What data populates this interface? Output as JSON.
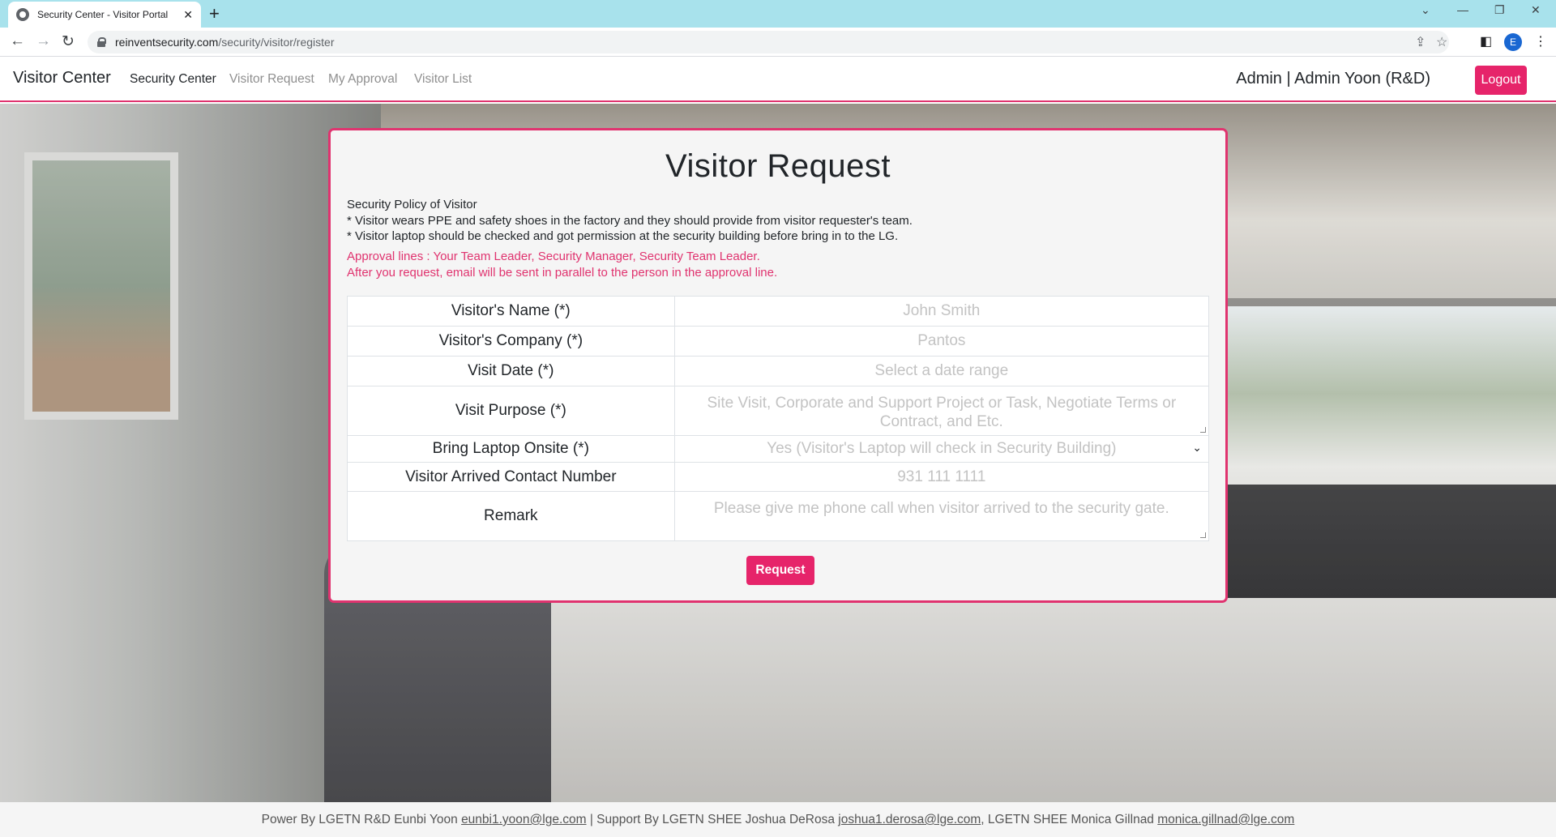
{
  "browser": {
    "tab_title": "Security Center - Visitor Portal",
    "tab_close": "✕",
    "new_tab": "+",
    "url_domain": "reinventsecurity.com",
    "url_path": "/security/visitor/register",
    "profile_initial": "E"
  },
  "navbar": {
    "brand": "Visitor Center",
    "links": [
      "Security Center",
      "Visitor Request",
      "My Approval",
      "Visitor List"
    ],
    "user": "Admin | Admin Yoon (R&D)",
    "logout": "Logout"
  },
  "form": {
    "title": "Visitor Request",
    "policy_heading": "Security Policy of Visitor",
    "policy_line1": "* Visitor wears PPE and safety shoes in the factory and they should provide from visitor requester's team.",
    "policy_line2": "* Visitor laptop should be checked and got permission at the security building before bring in to the LG.",
    "approval_line1": "Approval lines : Your Team Leader, Security Manager, Security Team Leader.",
    "approval_line2": "After you request, email will be sent in parallel to the person in the approval line.",
    "fields": {
      "name_label": "Visitor's Name (*)",
      "name_placeholder": "John Smith",
      "company_label": "Visitor's Company (*)",
      "company_placeholder": "Pantos",
      "date_label": "Visit Date (*)",
      "date_placeholder": "Select a date range",
      "purpose_label": "Visit Purpose (*)",
      "purpose_placeholder": "Site Visit, Corporate and Support Project or Task, Negotiate Terms or Contract, and Etc.",
      "laptop_label": "Bring Laptop Onsite (*)",
      "laptop_value": "Yes (Visitor's Laptop will check in Security Building)",
      "contact_label": "Visitor Arrived Contact Number",
      "contact_placeholder": "931 111 1111",
      "remark_label": "Remark",
      "remark_placeholder": "Please give me phone call when visitor arrived to the security gate."
    },
    "submit": "Request"
  },
  "footer": {
    "part1": "Power By LGETN R&D Eunbi Yoon ",
    "email1": "eunbi1.yoon@lge.com",
    "part2": " | Support By LGETN SHEE Joshua DeRosa ",
    "email2": "joshua1.derosa@lge.com",
    "part3": ", LGETN SHEE Monica Gillnad ",
    "email3": "monica.gillnad@lge.com"
  },
  "colors": {
    "accent": "#e6246a",
    "approval_text": "#e0336f",
    "tab_strip": "#a8e2ec"
  }
}
